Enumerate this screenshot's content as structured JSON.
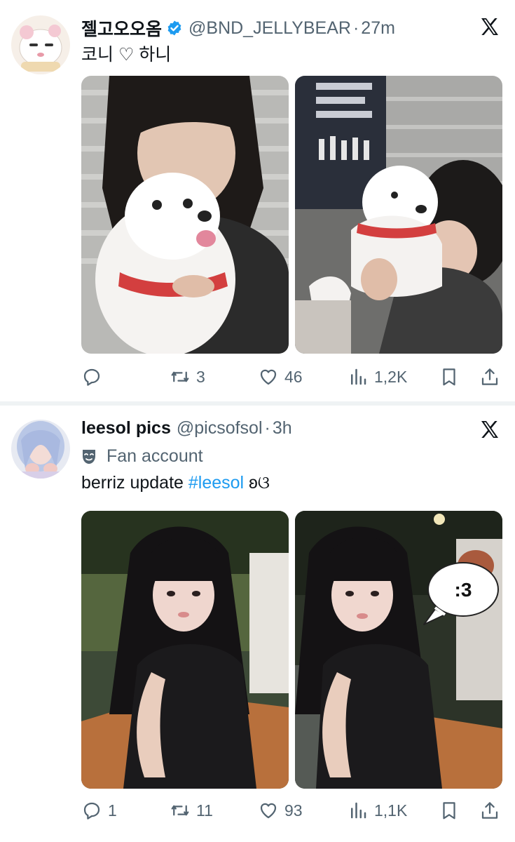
{
  "tweets": [
    {
      "name": "젤고오오옴",
      "handle": "@BND_JELLYBEAR",
      "time": "27m",
      "text": "코니 ♡ 하니",
      "stats": {
        "replies": "",
        "retweets": "3",
        "likes": "46",
        "views": "1,2K"
      }
    },
    {
      "name": "leesol pics",
      "handle": "@picsofsol",
      "time": "3h",
      "badge": "Fan account",
      "text_prefix": "berriz update ",
      "hashtag": "#leesol",
      "text_suffix": " ʚଓ",
      "sticker_text": ":3",
      "stats": {
        "replies": "1",
        "retweets": "11",
        "likes": "93",
        "views": "1,1K"
      }
    }
  ],
  "colors": {
    "text_primary": "#0f1419",
    "text_secondary": "#536471",
    "link": "#1d9bf0",
    "verified": "#1d9bf0",
    "divider": "#eff3f4"
  },
  "icons": [
    "reply-icon",
    "retweet-icon",
    "like-icon",
    "views-icon",
    "bookmark-icon",
    "share-icon",
    "x-logo-icon",
    "verified-badge-icon",
    "mask-icon"
  ]
}
